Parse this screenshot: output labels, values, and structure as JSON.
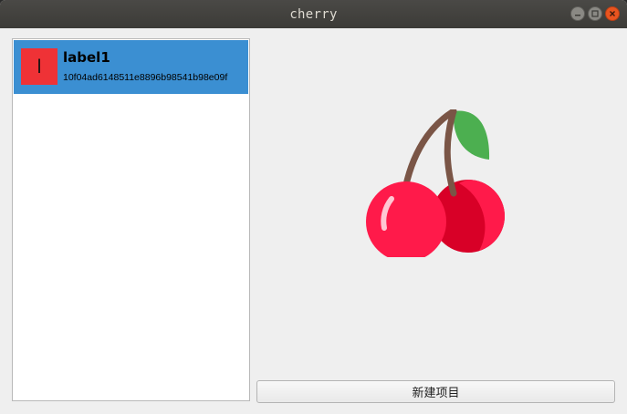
{
  "window": {
    "title": "cherry"
  },
  "list": {
    "items": [
      {
        "avatar_letter": "l",
        "title": "label1",
        "subtitle": "10f04ad6148511e8896b98541b98e09f",
        "selected": true
      }
    ]
  },
  "preview": {
    "image": "cherry-image"
  },
  "actions": {
    "new_item_label": "新建项目"
  },
  "colors": {
    "selection": "#3b8fd2",
    "avatar_bg": "#ef3236",
    "cherry_red": "#ff1a4a",
    "cherry_dark": "#d80027",
    "stem": "#7a5546",
    "leaf": "#4caf50"
  }
}
